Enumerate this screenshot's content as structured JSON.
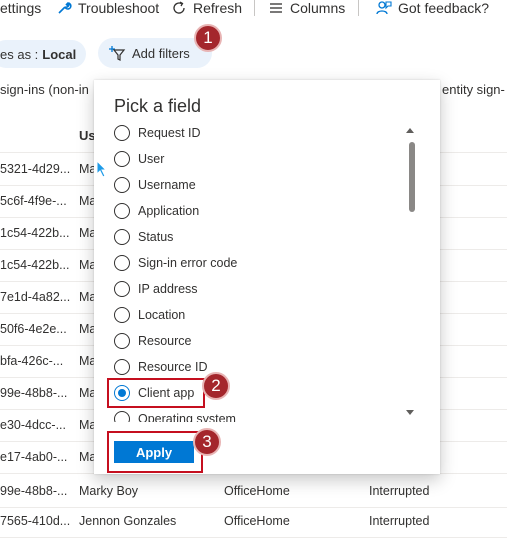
{
  "toolbar": {
    "items": [
      {
        "label": "ettings",
        "icon": "gear-icon"
      },
      {
        "label": "Troubleshoot",
        "icon": "wrench-icon"
      },
      {
        "label": "Refresh",
        "icon": "refresh-icon"
      },
      {
        "label": "Columns",
        "icon": "columns-icon"
      },
      {
        "label": "Got feedback?",
        "icon": "feedback-icon"
      }
    ]
  },
  "filters": {
    "scope_prefix": "es as :",
    "scope_value": "Local",
    "add_filters_label": "Add filters"
  },
  "tabs": {
    "left": "sign-ins (non-in",
    "right": "entity sign-"
  },
  "column_header": "Us",
  "rows": [
    {
      "id": "5321-4d29...",
      "user": "Ma",
      "app": "",
      "status": ""
    },
    {
      "id": "5c6f-4f9e-...",
      "user": "Ma",
      "app": "",
      "status": ""
    },
    {
      "id": "1c54-422b...",
      "user": "Ma",
      "app": "",
      "status": ""
    },
    {
      "id": "1c54-422b...",
      "user": "Ma",
      "app": "",
      "status": ""
    },
    {
      "id": "7e1d-4a82...",
      "user": "Ma",
      "app": "",
      "status": ""
    },
    {
      "id": "50f6-4e2e...",
      "user": "Ma",
      "app": "",
      "status": ""
    },
    {
      "id": "bfa-426c-...",
      "user": "Ma",
      "app": "",
      "status": ""
    },
    {
      "id": "99e-48b8-...",
      "user": "Ma",
      "app": "",
      "status": ""
    },
    {
      "id": "e30-4dcc-...",
      "user": "Ma",
      "app": "",
      "status": ""
    },
    {
      "id": "e17-4ab0-...",
      "user": "Ma",
      "app": "",
      "status": ""
    },
    {
      "id": "99e-48b8-...",
      "user": "Marky Boy",
      "app": "OfficeHome",
      "status": "Interrupted"
    },
    {
      "id": "7565-410d...",
      "user": "Jennon Gonzales",
      "app": "OfficeHome",
      "status": "Interrupted"
    }
  ],
  "panel": {
    "title": "Pick a field",
    "fields": [
      {
        "label": "Request ID",
        "checked": false
      },
      {
        "label": "User",
        "checked": false
      },
      {
        "label": "Username",
        "checked": false
      },
      {
        "label": "Application",
        "checked": false
      },
      {
        "label": "Status",
        "checked": false
      },
      {
        "label": "Sign-in error code",
        "checked": false
      },
      {
        "label": "IP address",
        "checked": false
      },
      {
        "label": "Location",
        "checked": false
      },
      {
        "label": "Resource",
        "checked": false
      },
      {
        "label": "Resource ID",
        "checked": false
      },
      {
        "label": "Client app",
        "checked": true
      },
      {
        "label": "Operating system",
        "checked": false
      }
    ],
    "apply_label": "Apply"
  },
  "callouts": [
    "1",
    "2",
    "3"
  ],
  "colors": {
    "accent": "#0078d4",
    "callout": "#a4262c",
    "highlight": "#c50f1f",
    "pill": "#eaf2fb"
  }
}
